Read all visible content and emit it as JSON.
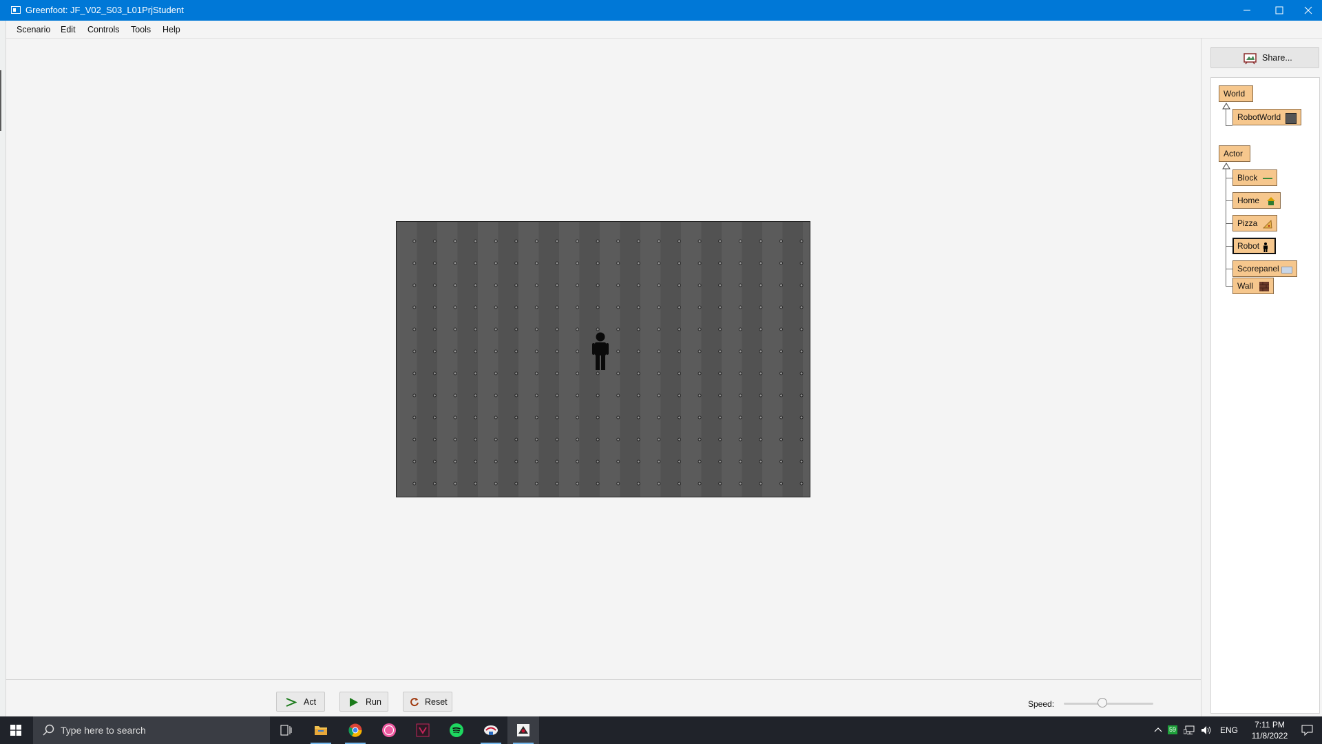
{
  "window": {
    "title": "Greenfoot: JF_V02_S03_L01PrjStudent"
  },
  "menu": {
    "items": [
      "Scenario",
      "Edit",
      "Controls",
      "Tools",
      "Help"
    ]
  },
  "share": {
    "label": "Share..."
  },
  "classes": {
    "world_root": "World",
    "world_subclasses": [
      "RobotWorld"
    ],
    "actor_root": "Actor",
    "actor_subclasses": [
      "Block",
      "Home",
      "Pizza",
      "Robot",
      "Scorepanel",
      "Wall"
    ],
    "selected": "Robot"
  },
  "controls": {
    "act": "Act",
    "run": "Run",
    "reset": "Reset",
    "speed_label": "Speed:",
    "speed_value": 0.43
  },
  "taskbar": {
    "search_placeholder": "Type here to search",
    "language": "ENG",
    "time": "7:11 PM",
    "date": "11/8/2022",
    "battery_badge": "59",
    "apps": [
      "task-view",
      "file-explorer",
      "chrome",
      "osu",
      "vortex",
      "spotify",
      "greenfoot-launcher",
      "greenfoot"
    ]
  },
  "colors": {
    "titlebar": "#0078d7",
    "class_box": "#f6c78d",
    "taskbar": "#20232a"
  }
}
